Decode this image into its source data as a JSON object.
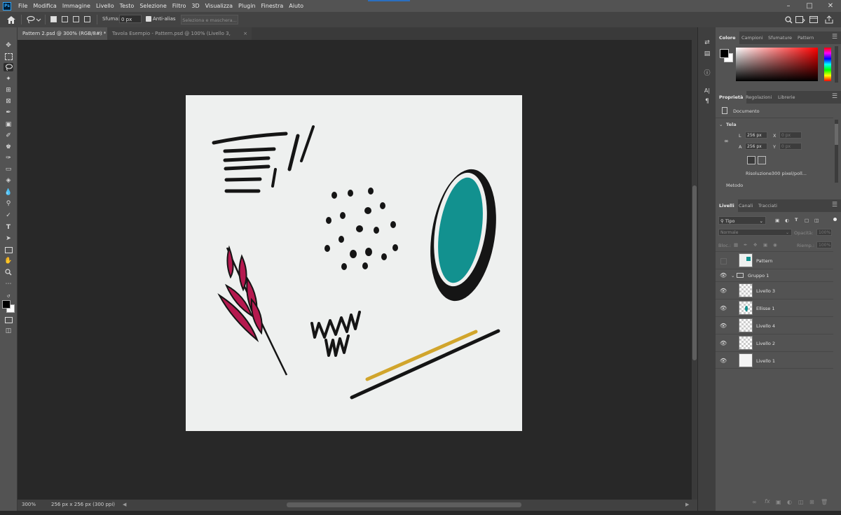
{
  "menu": {
    "logo": "Ps",
    "items": [
      "File",
      "Modifica",
      "Immagine",
      "Livello",
      "Testo",
      "Selezione",
      "Filtro",
      "3D",
      "Visualizza",
      "Plugin",
      "Finestra",
      "Aiuto"
    ]
  },
  "options_bar": {
    "feather_label": "Sfuma:",
    "feather_value": "0 px",
    "antialias_label": "Anti-alias",
    "select_mask_label": "Seleziona e maschera..."
  },
  "tabs": [
    {
      "label": "Pattern 2.psd @ 300% (RGB/8#) *",
      "active": true
    },
    {
      "label": "Tavola Esempio - Pattern.psd @ 100% (Livello 3, RGB/8#)",
      "active": false
    }
  ],
  "status": {
    "zoom": "300%",
    "doc_info": "256 px x 256 px (300 ppi)"
  },
  "color_panel": {
    "tabs": [
      "Colore",
      "Campioni",
      "Sfumature",
      "Pattern"
    ]
  },
  "properties_panel": {
    "tabs": [
      "Proprietà",
      "Regolazioni",
      "Librerie"
    ],
    "doc_label": "Documento",
    "canvas_label": "Tela",
    "width_label": "L",
    "width_value": "256 px",
    "height_label": "A",
    "height_value": "256 px",
    "x_label": "X",
    "x_value": "0 px",
    "y_label": "Y",
    "y_value": "0 px",
    "resolution_label": "Risoluzione:",
    "resolution_value": "300 pixel/poll...",
    "mode_label": "Metodo"
  },
  "layers_panel": {
    "tabs": [
      "Livelli",
      "Canali",
      "Tracciati"
    ],
    "filter_label": "Tipo",
    "blend_mode": "Normale",
    "opacity_label": "Opacità:",
    "opacity_value": "100%",
    "lock_label": "Bloc.:",
    "fill_label": "Riemp.:",
    "fill_value": "100%",
    "layers": [
      {
        "name": "Pattern",
        "visible": false
      },
      {
        "name": "Gruppo 1",
        "visible": true,
        "group": true
      },
      {
        "name": "Livello 3",
        "visible": true
      },
      {
        "name": "Ellisse 1",
        "visible": true
      },
      {
        "name": "Livello 4",
        "visible": true
      },
      {
        "name": "Livello 2",
        "visible": true
      },
      {
        "name": "Livello 1",
        "visible": true
      }
    ]
  },
  "colors": {
    "teal": "#12918f",
    "magenta": "#b5194f",
    "mustard": "#d1a52c",
    "ink": "#151515",
    "paper": "#eef0ef"
  }
}
